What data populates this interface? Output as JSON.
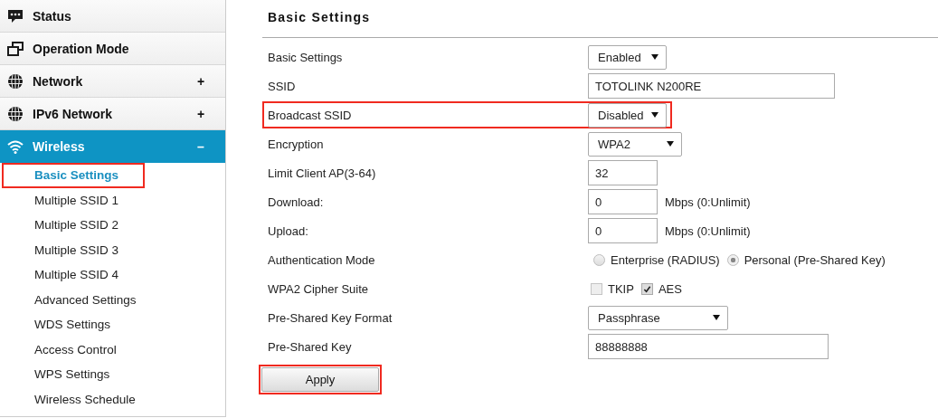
{
  "sidebar": {
    "items": [
      {
        "label": "Status",
        "selected": false
      },
      {
        "label": "Operation Mode",
        "selected": false
      },
      {
        "label": "Network",
        "toggle": "+",
        "selected": false
      },
      {
        "label": "IPv6 Network",
        "toggle": "+",
        "selected": false
      },
      {
        "label": "Wireless",
        "toggle": "–",
        "selected": true,
        "children": [
          {
            "label": "Basic Settings",
            "selected": true,
            "highlighted": true
          },
          {
            "label": "Multiple SSID 1",
            "selected": false,
            "highlighted": false
          },
          {
            "label": "Multiple SSID 2",
            "selected": false,
            "highlighted": false
          },
          {
            "label": "Multiple SSID 3",
            "selected": false,
            "highlighted": false
          },
          {
            "label": "Multiple SSID 4",
            "selected": false,
            "highlighted": false
          },
          {
            "label": "Advanced Settings",
            "selected": false,
            "highlighted": false
          },
          {
            "label": "WDS Settings",
            "selected": false,
            "highlighted": false
          },
          {
            "label": "Access Control",
            "selected": false,
            "highlighted": false
          },
          {
            "label": "WPS Settings",
            "selected": false,
            "highlighted": false
          },
          {
            "label": "Wireless Schedule",
            "selected": false,
            "highlighted": false
          }
        ]
      }
    ]
  },
  "main": {
    "title": "Basic Settings",
    "rows": [
      {
        "label": "Basic Settings",
        "kind": "select",
        "value": "Enabled",
        "highlighted": false
      },
      {
        "label": "SSID",
        "kind": "text",
        "value": "TOTOLINK N200RE",
        "highlighted": false
      },
      {
        "label": "Broadcast SSID",
        "kind": "select",
        "value": "Disabled",
        "highlighted": true
      },
      {
        "label": "Encryption",
        "kind": "select",
        "value": "WPA2",
        "highlighted": false
      },
      {
        "label": "Limit Client AP(3-64)",
        "kind": "text",
        "value": "32",
        "highlighted": false
      },
      {
        "label": "Download:",
        "kind": "text",
        "value": "0",
        "unit": "Mbps (0:Unlimit)",
        "highlighted": false
      },
      {
        "label": "Upload:",
        "kind": "text",
        "value": "0",
        "unit": "Mbps (0:Unlimit)",
        "highlighted": false
      },
      {
        "label": "Authentication Mode",
        "kind": "radio",
        "options": [
          {
            "label": "Enterprise (RADIUS)",
            "selected": false
          },
          {
            "label": "Personal (Pre-Shared Key)",
            "selected": true
          }
        ],
        "highlighted": false
      },
      {
        "label": "WPA2 Cipher Suite",
        "kind": "checkbox",
        "options": [
          {
            "label": "TKIP",
            "checked": false
          },
          {
            "label": "AES",
            "checked": true
          }
        ],
        "highlighted": false
      },
      {
        "label": "Pre-Shared Key Format",
        "kind": "select",
        "value": "Passphrase",
        "highlighted": false
      },
      {
        "label": "Pre-Shared Key",
        "kind": "text",
        "value": "88888888",
        "highlighted": false
      }
    ],
    "apply": {
      "label": "Apply",
      "highlighted": true
    }
  }
}
